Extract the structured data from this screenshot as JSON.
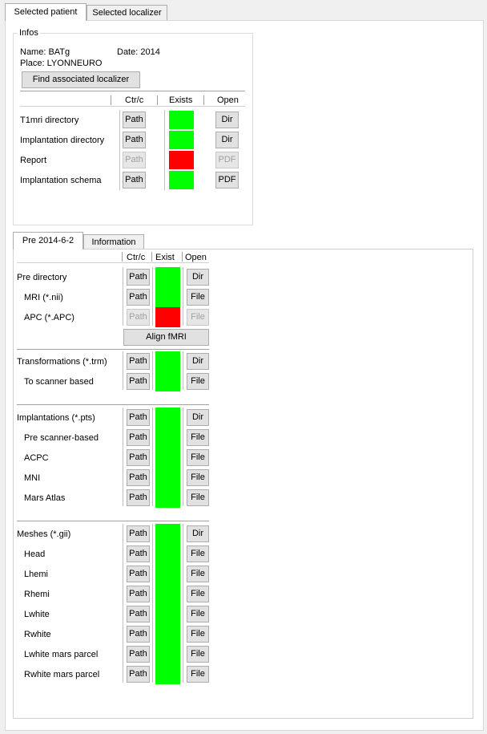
{
  "tabs": [
    "Selected patient",
    "Selected localizer"
  ],
  "infos": {
    "title": "Infos",
    "name": "Name: BATg",
    "date": "Date: 2014",
    "place": "Place: LYONNEURO",
    "find_button": "Find associated localizer",
    "headers": {
      "ctrc": "Ctr/c",
      "exists": "Exists",
      "open": "Open"
    },
    "rows": [
      {
        "label": "T1mri directory",
        "path": "Path",
        "path_enabled": true,
        "status": "green",
        "open": "Dir",
        "open_enabled": true
      },
      {
        "label": "Implantation directory",
        "path": "Path",
        "path_enabled": true,
        "status": "green",
        "open": "Dir",
        "open_enabled": true
      },
      {
        "label": "Report",
        "path": "Path",
        "path_enabled": false,
        "status": "red",
        "open": "PDF",
        "open_enabled": false
      },
      {
        "label": "Implantation schema",
        "path": "Path",
        "path_enabled": true,
        "status": "green",
        "open": "PDF",
        "open_enabled": true
      }
    ]
  },
  "subtabs": [
    "Pre 2014-6-2",
    "Information"
  ],
  "pre": {
    "headers": {
      "ctrc": "Ctr/c",
      "exist": "Exist",
      "open": "Open"
    },
    "align_button": "Align fMRI",
    "sections": [
      {
        "rows": [
          {
            "label": "Pre directory",
            "indent": false,
            "path": "Path",
            "path_enabled": true,
            "status": "green",
            "open": "Dir",
            "open_enabled": true
          },
          {
            "label": "MRI (*.nii)",
            "indent": true,
            "path": "Path",
            "path_enabled": true,
            "status": "green",
            "open": "File",
            "open_enabled": true
          },
          {
            "label": "APC (*.APC)",
            "indent": true,
            "path": "Path",
            "path_enabled": false,
            "status": "red",
            "open": "File",
            "open_enabled": false
          }
        ]
      },
      {
        "rows": [
          {
            "label": "Transformations (*.trm)",
            "indent": false,
            "path": "Path",
            "path_enabled": true,
            "status": "green",
            "open": "Dir",
            "open_enabled": true
          },
          {
            "label": "To scanner based",
            "indent": true,
            "path": "Path",
            "path_enabled": true,
            "status": "green",
            "open": "File",
            "open_enabled": true
          }
        ]
      },
      {
        "rows": [
          {
            "label": "Implantations (*.pts)",
            "indent": false,
            "path": "Path",
            "path_enabled": true,
            "status": "green",
            "open": "Dir",
            "open_enabled": true
          },
          {
            "label": "Pre scanner-based",
            "indent": true,
            "path": "Path",
            "path_enabled": true,
            "status": "green",
            "open": "File",
            "open_enabled": true
          },
          {
            "label": "ACPC",
            "indent": true,
            "path": "Path",
            "path_enabled": true,
            "status": "green",
            "open": "File",
            "open_enabled": true
          },
          {
            "label": "MNI",
            "indent": true,
            "path": "Path",
            "path_enabled": true,
            "status": "green",
            "open": "File",
            "open_enabled": true
          },
          {
            "label": "Mars Atlas",
            "indent": true,
            "path": "Path",
            "path_enabled": true,
            "status": "green",
            "open": "File",
            "open_enabled": true
          }
        ]
      },
      {
        "rows": [
          {
            "label": "Meshes (*.gii)",
            "indent": false,
            "path": "Path",
            "path_enabled": true,
            "status": "green",
            "open": "Dir",
            "open_enabled": true
          },
          {
            "label": "Head",
            "indent": true,
            "path": "Path",
            "path_enabled": true,
            "status": "green",
            "open": "File",
            "open_enabled": true
          },
          {
            "label": "Lhemi",
            "indent": true,
            "path": "Path",
            "path_enabled": true,
            "status": "green",
            "open": "File",
            "open_enabled": true
          },
          {
            "label": "Rhemi",
            "indent": true,
            "path": "Path",
            "path_enabled": true,
            "status": "green",
            "open": "File",
            "open_enabled": true
          },
          {
            "label": "Lwhite",
            "indent": true,
            "path": "Path",
            "path_enabled": true,
            "status": "green",
            "open": "File",
            "open_enabled": true
          },
          {
            "label": "Rwhite",
            "indent": true,
            "path": "Path",
            "path_enabled": true,
            "status": "green",
            "open": "File",
            "open_enabled": true
          },
          {
            "label": "Lwhite mars parcel",
            "indent": true,
            "path": "Path",
            "path_enabled": true,
            "status": "green",
            "open": "File",
            "open_enabled": true
          },
          {
            "label": "Rwhite mars parcel",
            "indent": true,
            "path": "Path",
            "path_enabled": true,
            "status": "green",
            "open": "File",
            "open_enabled": true
          }
        ]
      }
    ]
  }
}
